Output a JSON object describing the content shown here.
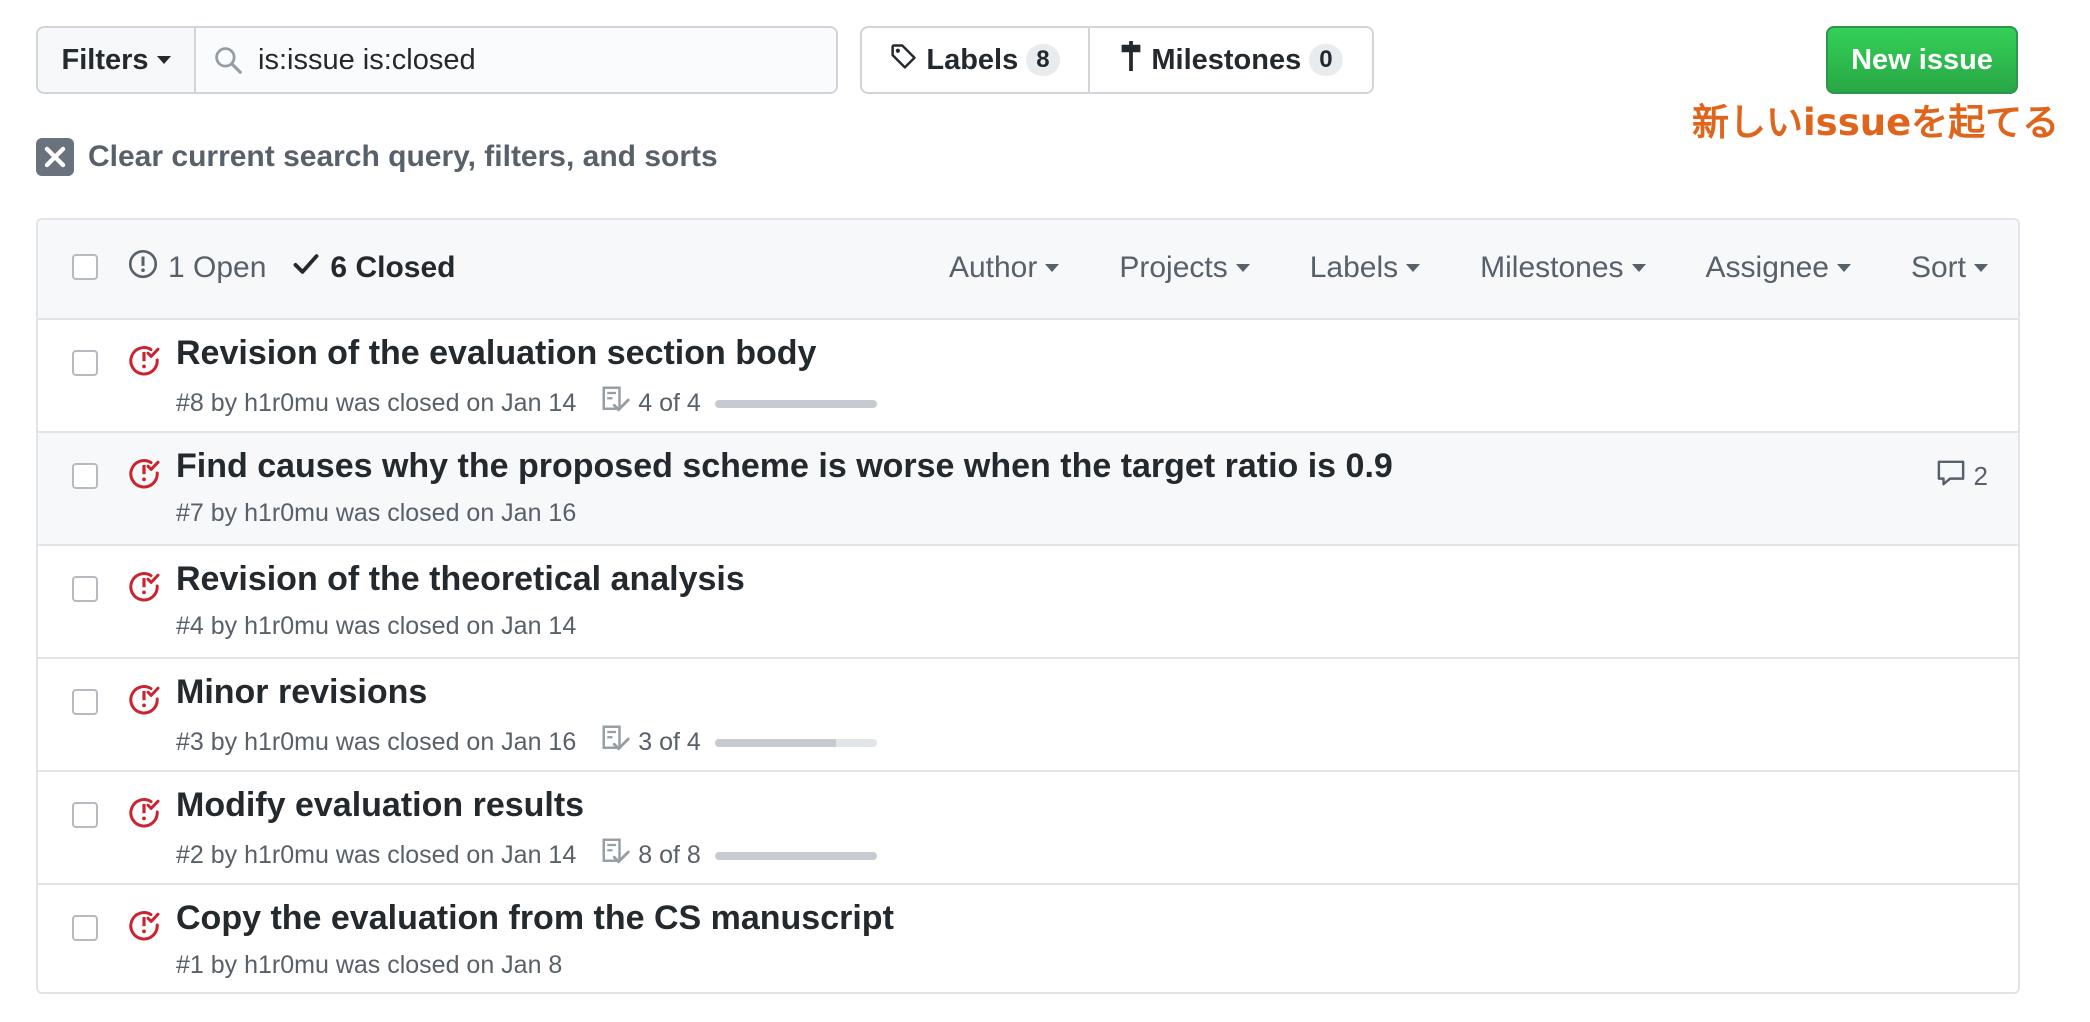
{
  "toolbar": {
    "filters_label": "Filters",
    "search_value": "is:issue is:closed",
    "labels_label": "Labels",
    "labels_count": "8",
    "milestones_label": "Milestones",
    "milestones_count": "0",
    "new_issue_label": "New issue",
    "annotation": "新しいissueを起てる"
  },
  "clear_query": {
    "label": "Clear current search query, filters, and sorts"
  },
  "list_header": {
    "open_label": "1 Open",
    "closed_label": "6 Closed",
    "menus": [
      "Author",
      "Projects",
      "Labels",
      "Milestones",
      "Assignee",
      "Sort"
    ]
  },
  "issues": [
    {
      "title": "Revision of the evaluation section body",
      "meta": "#8 by h1r0mu was closed on Jan 14",
      "tasks": "4 of 4",
      "progress": 1.0,
      "comments": ""
    },
    {
      "title": "Find causes why the proposed scheme is worse when the target ratio is 0.9",
      "meta": "#7 by h1r0mu was closed on Jan 16",
      "tasks": "",
      "progress": null,
      "comments": "2"
    },
    {
      "title": "Revision of the theoretical analysis",
      "meta": "#4 by h1r0mu was closed on Jan 14",
      "tasks": "",
      "progress": null,
      "comments": ""
    },
    {
      "title": "Minor revisions",
      "meta": "#3 by h1r0mu was closed on Jan 16",
      "tasks": "3 of 4",
      "progress": 0.75,
      "comments": ""
    },
    {
      "title": "Modify evaluation results",
      "meta": "#2 by h1r0mu was closed on Jan 14",
      "tasks": "8 of 8",
      "progress": 1.0,
      "comments": ""
    },
    {
      "title": "Copy the evaluation from the CS manuscript",
      "meta": "#1 by h1r0mu was closed on Jan 8",
      "tasks": "",
      "progress": null,
      "comments": ""
    }
  ],
  "colors": {
    "accent_green": "#2ea44f",
    "closed_icon_red": "#cb2431",
    "annotation": "#e0651c"
  }
}
